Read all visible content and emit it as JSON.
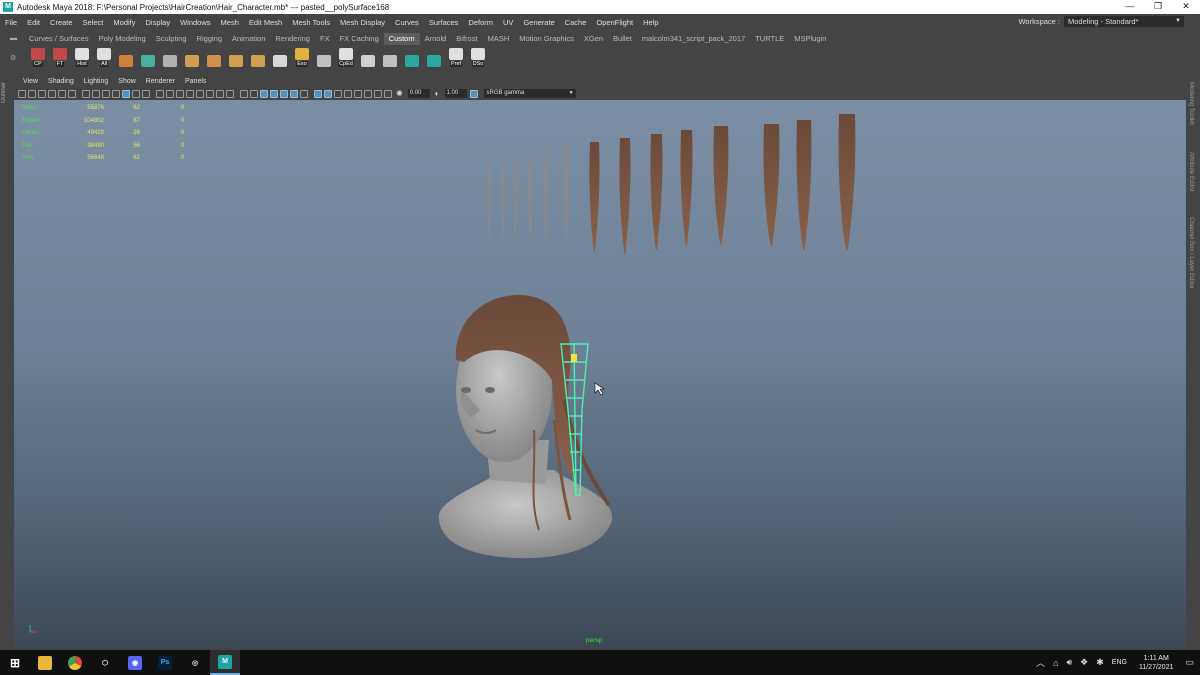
{
  "window": {
    "title": "Autodesk Maya 2018: F:\\Personal Projects\\HairCreation\\Hair_Character.mb*   ---   pasted__polySurface168",
    "minimize": "—",
    "restore": "❐",
    "close": "✕"
  },
  "menus": [
    "File",
    "Edit",
    "Create",
    "Select",
    "Modify",
    "Display",
    "Windows",
    "Mesh",
    "Edit Mesh",
    "Mesh Tools",
    "Mesh Display",
    "Curves",
    "Surfaces",
    "Deform",
    "UV",
    "Generate",
    "Cache",
    "OpenFlight",
    "Help"
  ],
  "workspace": {
    "label": "Workspace :",
    "value": "Modeling - Standard*"
  },
  "shelf": {
    "tabs": [
      "Curves / Surfaces",
      "Poly Modeling",
      "Sculpting",
      "Rigging",
      "Animation",
      "Rendering",
      "FX",
      "FX Caching",
      "Custom",
      "Arnold",
      "Bifrost",
      "MASH",
      "Motion Graphics",
      "XGen",
      "Bullet",
      "malcolm341_script_pack_2017",
      "TURTLE",
      "MSPlugin"
    ],
    "active_tab": "Custom",
    "buttons": [
      {
        "icon": "cp-tool-icon",
        "label": "CP",
        "color": "#c04848"
      },
      {
        "icon": "ft-tool-icon",
        "label": "FT",
        "color": "#c04848"
      },
      {
        "icon": "hist-icon",
        "label": "Hist",
        "color": "#e0e0e0"
      },
      {
        "icon": "all-icon",
        "label": "All",
        "color": "#e0e0e0"
      },
      {
        "icon": "render-sphere-icon",
        "label": "",
        "color": "#d0823a"
      },
      {
        "icon": "sphere-icon",
        "label": "",
        "color": "#4ab0a0"
      },
      {
        "icon": "uv-checker-icon",
        "label": "",
        "color": "#b0b0b0"
      },
      {
        "icon": "pivot-icon",
        "label": "",
        "color": "#d0a050"
      },
      {
        "icon": "center-pivot-icon",
        "label": "",
        "color": "#d09050"
      },
      {
        "icon": "freeze-icon",
        "label": "",
        "color": "#d0a050"
      },
      {
        "icon": "grid-icon",
        "label": "",
        "color": "#d0a050"
      },
      {
        "icon": "cube-icon",
        "label": "",
        "color": "#d8d8d8"
      },
      {
        "icon": "folder-icon",
        "label": "Exo",
        "color": "#e0b040"
      },
      {
        "icon": "import-icon",
        "label": "",
        "color": "#c0c0c0"
      },
      {
        "icon": "copy-paste-icon",
        "label": "CpEd",
        "color": "#e0e0e0"
      },
      {
        "icon": "lattice-icon",
        "label": "",
        "color": "#d0d0d0"
      },
      {
        "icon": "brush-icon",
        "label": "",
        "color": "#c0c0c0"
      },
      {
        "icon": "arnold-icon",
        "label": "",
        "color": "#2aa8a0"
      },
      {
        "icon": "arnold-light-icon",
        "label": "",
        "color": "#2aa8a0"
      },
      {
        "icon": "pref-icon",
        "label": "Pref",
        "color": "#e0e0e0"
      },
      {
        "icon": "dso-icon",
        "label": "DSo",
        "color": "#e0e0e0"
      }
    ]
  },
  "left_panel": {
    "label": "Outliner"
  },
  "right_panel": {
    "labels": [
      "Modeling Toolkit",
      "Attribute Editor",
      "Channel Box / Layer Editor"
    ]
  },
  "viewport": {
    "menu": [
      "View",
      "Shading",
      "Lighting",
      "Show",
      "Renderer",
      "Panels"
    ],
    "toolbar": {
      "field1": "0.00",
      "field2": "1.00",
      "color_space": "sRGB gamma"
    },
    "hud": [
      {
        "name": "Verts:",
        "v1": "55876",
        "v2": "62",
        "v3": "0"
      },
      {
        "name": "Edges:",
        "v1": "104802",
        "v2": "87",
        "v3": "0"
      },
      {
        "name": "Faces:",
        "v1": "49429",
        "v2": "26",
        "v3": "0"
      },
      {
        "name": "Tris:",
        "v1": "98490",
        "v2": "56",
        "v3": "0"
      },
      {
        "name": "UVs:",
        "v1": "56648",
        "v2": "62",
        "v3": "0"
      }
    ],
    "camera_label": "persp"
  },
  "taskbar": {
    "apps": [
      {
        "icon": "windows-start-icon",
        "glyph": "⊞",
        "bg": "#101010",
        "fg": "#ffffff"
      },
      {
        "icon": "file-explorer-icon",
        "glyph": "",
        "bg": "#e8b83a",
        "fg": "#000"
      },
      {
        "icon": "chrome-icon",
        "glyph": "",
        "bg": "#d94a3a",
        "fg": "#fff"
      },
      {
        "icon": "unity-icon",
        "glyph": "⬡",
        "bg": "#101010",
        "fg": "#eee"
      },
      {
        "icon": "discord-icon",
        "glyph": "◉",
        "bg": "#5865f2",
        "fg": "#fff"
      },
      {
        "icon": "photoshop-icon",
        "glyph": "Ps",
        "bg": "#0a1e34",
        "fg": "#31a8ff"
      },
      {
        "icon": "blender-icon",
        "glyph": "◎",
        "bg": "#101010",
        "fg": "#ddd"
      },
      {
        "icon": "maya-icon",
        "glyph": "M",
        "bg": "#1fa3a3",
        "fg": "#fff"
      }
    ],
    "tray": {
      "language": "ENG",
      "time": "1:11 AM",
      "date": "11/27/2021"
    }
  }
}
